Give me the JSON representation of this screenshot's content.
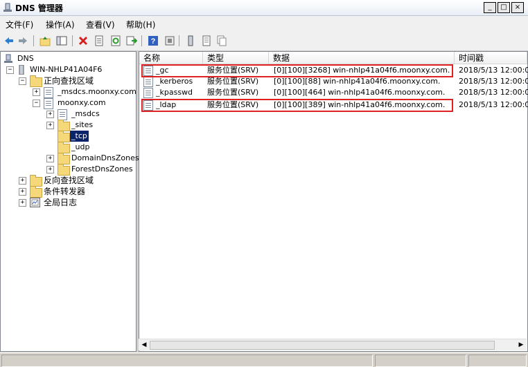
{
  "window": {
    "title": "DNS 管理器",
    "buttons": {
      "minimize": "_",
      "maximize": "□",
      "close": "×"
    }
  },
  "menu": [
    {
      "label": "文件(F)"
    },
    {
      "label": "操作(A)"
    },
    {
      "label": "查看(V)"
    },
    {
      "label": "帮助(H)"
    }
  ],
  "toolbar": {
    "icons": [
      "back-arrow-icon",
      "forward-arrow-icon",
      "up-folder-icon",
      "show-tree-icon",
      "delete-icon",
      "properties-icon",
      "refresh-icon",
      "export-list-icon",
      "help-icon",
      "record-icon",
      "list-icon",
      "copy-icon"
    ]
  },
  "tree": {
    "root": "DNS",
    "server": "WIN-NHLP41A04F6",
    "forward_zones": "正向查找区域",
    "msdcs_zone": "_msdcs.moonxy.com",
    "zone": "moonxy.com",
    "msdcs": "_msdcs",
    "sites": "_sites",
    "tcp": "_tcp",
    "udp": "_udp",
    "domain_dns_zones": "DomainDnsZones",
    "forest_dns_zones": "ForestDnsZones",
    "reverse_zones": "反向查找区域",
    "conditional_forwarders": "条件转发器",
    "global_logs": "全局日志"
  },
  "list": {
    "columns": [
      "名称",
      "类型",
      "数据",
      "时间戳"
    ],
    "rows": [
      {
        "name": "_gc",
        "type": "服务位置(SRV)",
        "data": "[0][100][3268] win-nhlp41a04f6.moonxy.com.",
        "timestamp": "2018/5/13 12:00:0",
        "highlighted": true
      },
      {
        "name": "_kerberos",
        "type": "服务位置(SRV)",
        "data": "[0][100][88] win-nhlp41a04f6.moonxy.com.",
        "timestamp": "2018/5/13 12:00:0",
        "highlighted": false
      },
      {
        "name": "_kpasswd",
        "type": "服务位置(SRV)",
        "data": "[0][100][464] win-nhlp41a04f6.moonxy.com.",
        "timestamp": "2018/5/13 12:00:0",
        "highlighted": false
      },
      {
        "name": "_ldap",
        "type": "服务位置(SRV)",
        "data": "[0][100][389] win-nhlp41a04f6.moonxy.com.",
        "timestamp": "2018/5/13 12:00:0",
        "highlighted": true
      }
    ]
  },
  "colors": {
    "highlight_border": "#e02020",
    "selection": "#0a246a"
  }
}
